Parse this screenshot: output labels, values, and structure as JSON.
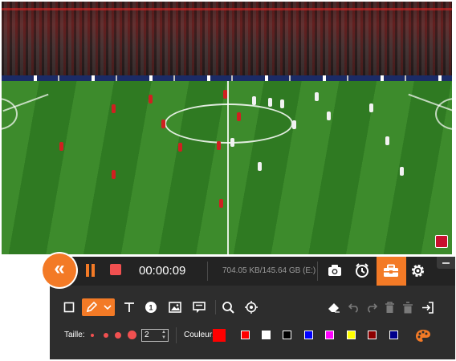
{
  "recorder": {
    "timer": "00:00:09",
    "file_size": "704.05 KB/145.64 GB (E:)",
    "toggle_icon": "double-chevron-left-icon"
  },
  "top_icons": [
    "pause-icon",
    "stop-icon",
    "camera-icon",
    "alarm-clock-icon",
    "toolbox-icon",
    "gear-icon",
    "minimize-icon"
  ],
  "tools": [
    "rectangle-icon",
    "pen-icon",
    "chevron-down-icon",
    "text-icon",
    "number-badge-icon",
    "image-icon",
    "callout-icon",
    "magnifier-icon",
    "spotlight-icon",
    "eraser-icon",
    "undo-icon",
    "redo-icon",
    "trash-icon",
    "clear-all-icon",
    "exit-icon"
  ],
  "options": {
    "size_label": "Taille:",
    "size_value": "2",
    "color_label": "Couleur:",
    "selected_color": "#ff0000",
    "colors": [
      "#ff0000",
      "#ffffff",
      "#000000",
      "#0000ff",
      "#ff00ff",
      "#ffff00",
      "#8b0000",
      "#00008b"
    ]
  },
  "accent": "#f37a26"
}
